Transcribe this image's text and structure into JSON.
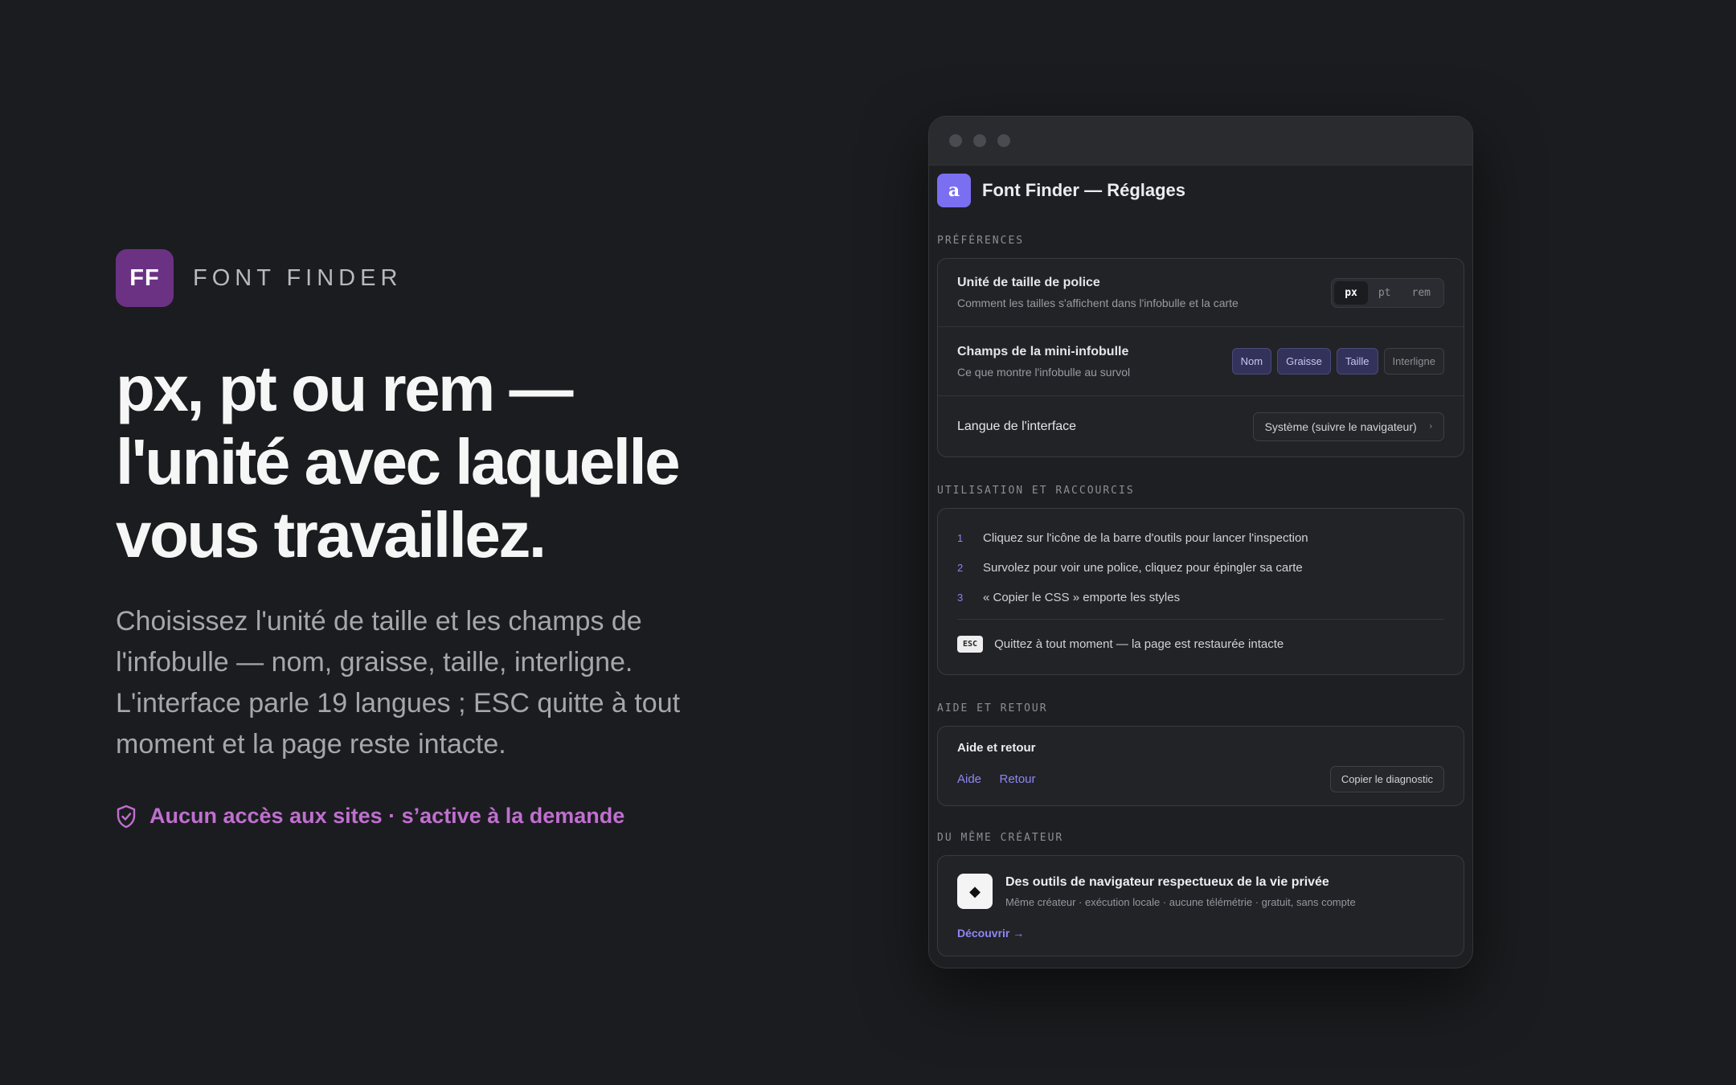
{
  "hero": {
    "logo_text": "FF",
    "brand_name": "FONT FINDER",
    "headline": [
      "px, pt ou rem —",
      "l'unité avec laquelle",
      "vous travaillez."
    ],
    "lede": "Choisissez l'unité de taille et les champs de l'infobulle — nom, graisse, taille, interligne. L'interface parle 19 langues ; ESC quitte à tout moment et la page reste intacte.",
    "assurance": "Aucun accès aux sites · s’active à la demande",
    "assurance_icon": "shield-check-icon",
    "accent_color": "#c06fd0"
  },
  "window": {
    "app_icon_glyph": "a",
    "app_title": "Font Finder — Réglages",
    "preferences": {
      "label": "PRÉFÉRENCES",
      "unit": {
        "title": "Unité de taille de police",
        "subtitle": "Comment les tailles s'affichent dans l'infobulle et la carte",
        "options": [
          "px",
          "pt",
          "rem"
        ],
        "selected": "px"
      },
      "tooltip_fields": {
        "title": "Champs de la mini-infobulle",
        "subtitle": "Ce que montre l'infobulle au survol",
        "chips": [
          {
            "label": "Nom",
            "on": true
          },
          {
            "label": "Graisse",
            "on": true
          },
          {
            "label": "Taille",
            "on": true
          },
          {
            "label": "Interligne",
            "on": false
          }
        ]
      },
      "language": {
        "title": "Langue de l'interface",
        "value": "Système (suivre le navigateur)"
      }
    },
    "usage": {
      "label": "UTILISATION ET RACCOURCIS",
      "steps": [
        {
          "num": "1",
          "text": "Cliquez sur l'icône de la barre d'outils pour lancer l'inspection"
        },
        {
          "num": "2",
          "text": "Survolez pour voir une police, cliquez pour épingler sa carte"
        },
        {
          "num": "3",
          "text": "« Copier le CSS » emporte les styles"
        }
      ],
      "esc_key": "ESC",
      "esc_text": "Quittez à tout moment — la page est restaurée intacte"
    },
    "help": {
      "label": "AIDE ET RETOUR",
      "title": "Aide et retour",
      "link_help": "Aide",
      "link_feedback": "Retour",
      "copy_button": "Copier le diagnostic"
    },
    "creator": {
      "label": "DU MÊME CRÉATEUR",
      "icon_glyph": "◆",
      "title": "Des outils de navigateur respectueux de la vie privée",
      "subtitle": "Même créateur · exécution locale · aucune télémétrie · gratuit, sans compte",
      "link": "Découvrir →"
    }
  }
}
